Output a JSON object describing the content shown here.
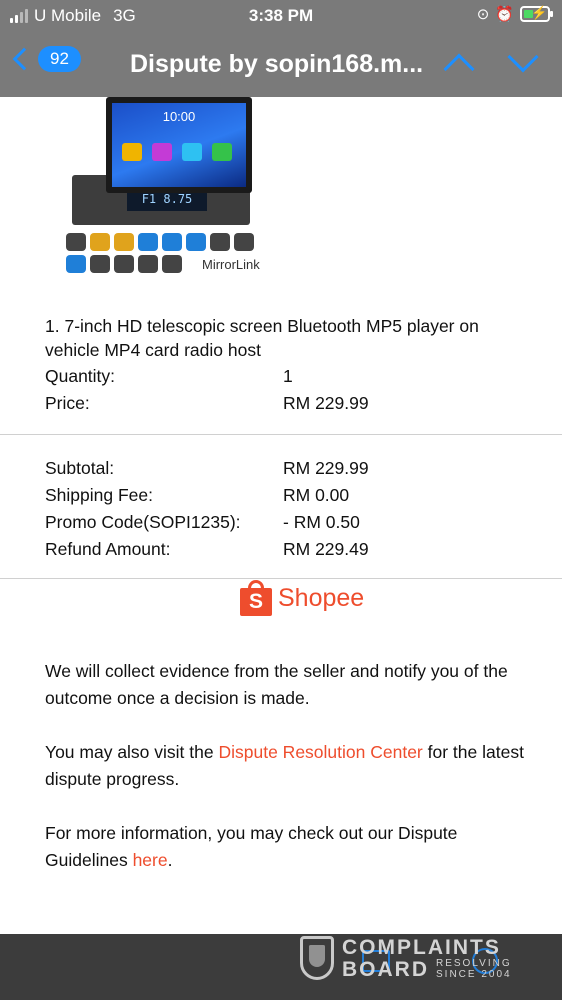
{
  "status_bar": {
    "carrier": "U Mobile",
    "network": "3G",
    "time": "3:38 PM",
    "battery_level": 0.4,
    "battery_color": "#4cd964"
  },
  "nav": {
    "back_count": "92",
    "title": "Dispute by sopin168.m...",
    "accent_color": "#1d8fff"
  },
  "product_image": {
    "screen_clock": "10:00",
    "display_readout": "F1 8.75",
    "mirrorlink_text": "MirrorLink"
  },
  "item": {
    "name": "1. 7-inch HD telescopic screen Bluetooth MP5 player on vehicle MP4 card radio host",
    "quantity_label": "Quantity:",
    "quantity_value": "1",
    "price_label": "Price:",
    "price_value": "RM 229.99"
  },
  "summary": {
    "subtotal_label": "Subtotal:",
    "subtotal_value": "RM 229.99",
    "shipping_label": "Shipping Fee:",
    "shipping_value": "RM 0.00",
    "promo_label": "Promo Code(SOPI1235):",
    "promo_value": "- RM 0.50",
    "refund_label": "Refund Amount:",
    "refund_value": "RM 229.49"
  },
  "brand": {
    "logo_letter": "S",
    "name": "Shopee",
    "color": "#ee4d2d"
  },
  "body": {
    "p1": "We will collect evidence from the seller and notify you of the outcome once a decision is made.",
    "p2_before": "You may also visit the ",
    "p2_link": "Dispute Resolution Center",
    "p2_after": " for the latest dispute progress.",
    "p3_before": "For more information, you may check out our Dispute Guidelines ",
    "p3_link": "here",
    "p3_after": "."
  },
  "watermark": {
    "line1": "COMPLAINTS",
    "line2": "BOARD",
    "tag1": "RESOLVING",
    "tag2": "SINCE 2004"
  }
}
